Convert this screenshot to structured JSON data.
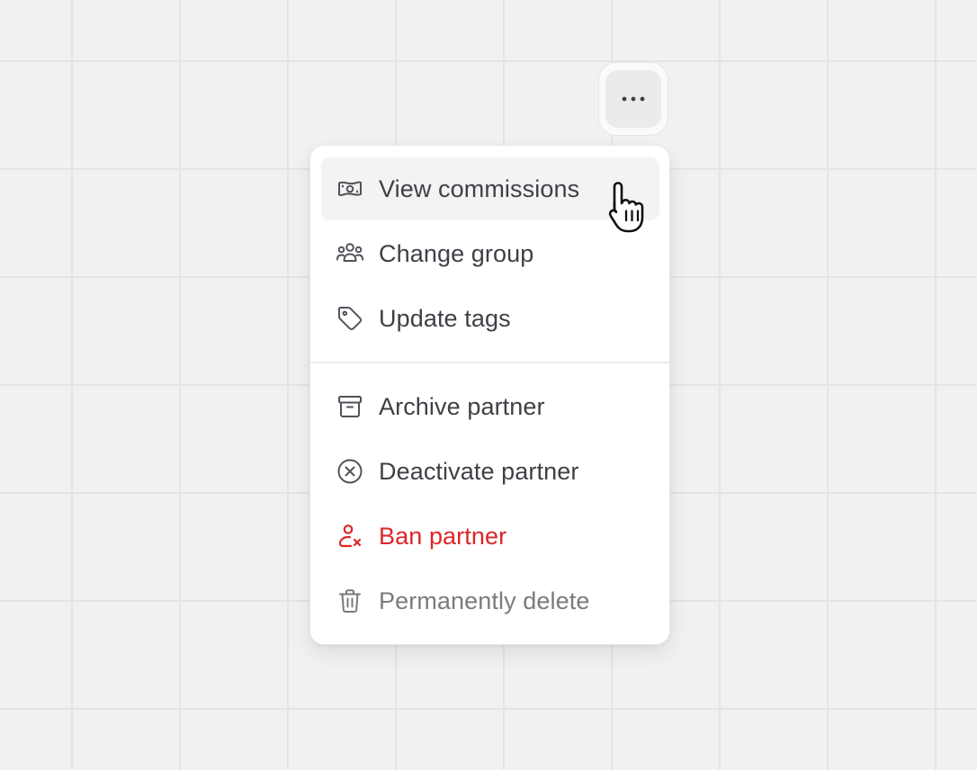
{
  "more_button": {
    "icon": "more-horizontal-icon",
    "glyph": "···"
  },
  "menu": {
    "groups": [
      [
        {
          "label": "View commissions",
          "icon": "money-icon",
          "tone": "default",
          "hover": true
        },
        {
          "label": "Change group",
          "icon": "users-group-icon",
          "tone": "default"
        },
        {
          "label": "Update tags",
          "icon": "tag-icon",
          "tone": "default"
        }
      ],
      [
        {
          "label": "Archive partner",
          "icon": "archive-box-icon",
          "tone": "default"
        },
        {
          "label": "Deactivate partner",
          "icon": "circle-x-icon",
          "tone": "default"
        },
        {
          "label": "Ban partner",
          "icon": "user-x-icon",
          "tone": "danger"
        },
        {
          "label": "Permanently delete",
          "icon": "trash-icon",
          "tone": "muted"
        }
      ]
    ]
  },
  "colors": {
    "text": "#3f3f46",
    "danger": "#dc2626",
    "muted": "#7a7a7f",
    "hover": "#f3f3f4"
  },
  "cursor": "hand-pointer-icon"
}
